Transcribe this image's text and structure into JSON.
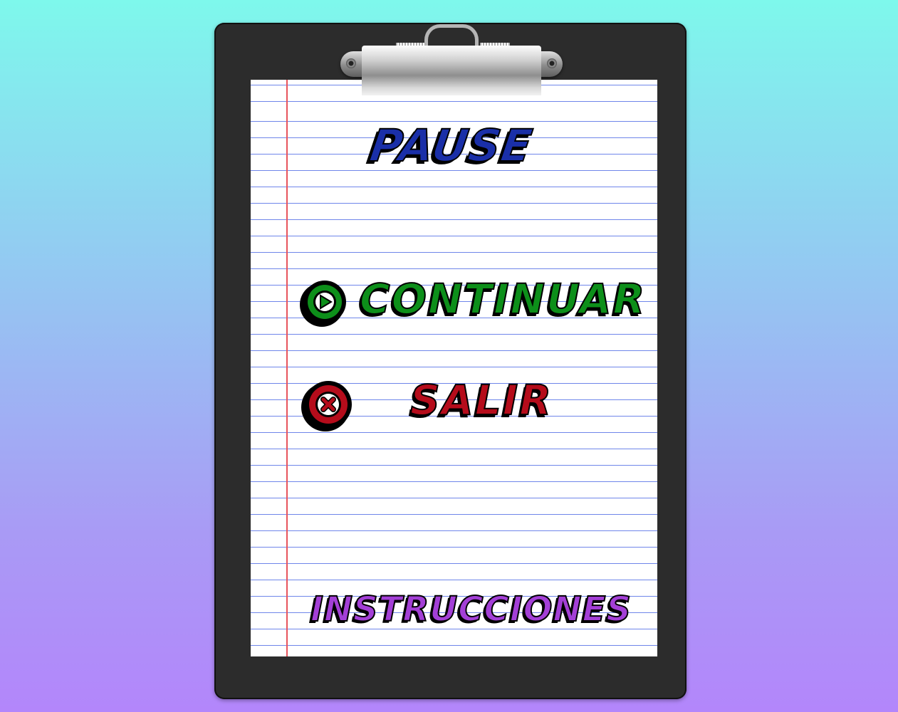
{
  "pause_menu": {
    "title": "PAUSE",
    "continue_label": "CONTINUAR",
    "exit_label": "SALIR",
    "instructions_label": "INSTRUCCIONES"
  },
  "icons": {
    "continue": "play-circle-icon",
    "exit": "close-circle-icon"
  },
  "colors": {
    "title": "#1a2fa8",
    "continue": "#0d8f1a",
    "exit": "#b50c1b",
    "instructions": "#a33fd6",
    "margin_line": "#e8545c",
    "ruled_line": "#6f86ea"
  }
}
